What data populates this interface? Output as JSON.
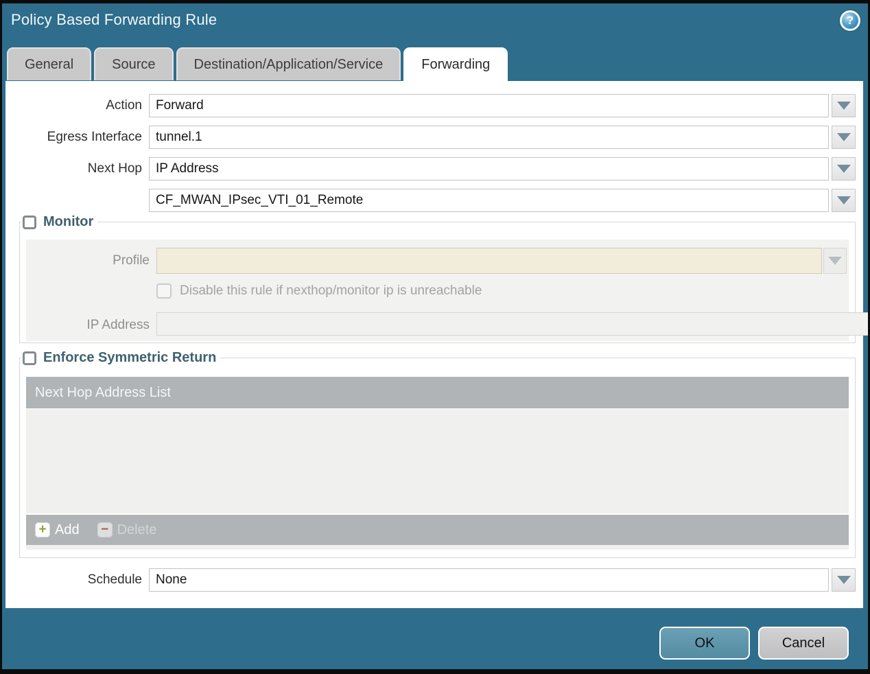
{
  "dialog": {
    "title": "Policy Based Forwarding Rule"
  },
  "icons": {
    "help": "?",
    "add_plus": "+",
    "delete_minus": "−"
  },
  "tabs": [
    {
      "label": "General",
      "active": false
    },
    {
      "label": "Source",
      "active": false
    },
    {
      "label": "Destination/Application/Service",
      "active": false
    },
    {
      "label": "Forwarding",
      "active": true
    }
  ],
  "form": {
    "action": {
      "label": "Action",
      "value": "Forward"
    },
    "egress_interface": {
      "label": "Egress Interface",
      "value": "tunnel.1"
    },
    "next_hop": {
      "label": "Next Hop",
      "value": "IP Address"
    },
    "next_hop_address": {
      "value": "CF_MWAN_IPsec_VTI_01_Remote"
    },
    "schedule": {
      "label": "Schedule",
      "value": "None"
    }
  },
  "monitor": {
    "legend": "Monitor",
    "checked": false,
    "profile": {
      "label": "Profile",
      "value": "",
      "disabled": true
    },
    "disable_rule_checkbox": {
      "label": "Disable this rule if nexthop/monitor ip is unreachable",
      "checked": false,
      "disabled": true
    },
    "ip_address": {
      "label": "IP Address",
      "value": "",
      "disabled": true
    }
  },
  "symmetric_return": {
    "legend": "Enforce Symmetric Return",
    "checked": false,
    "table": {
      "header": "Next Hop Address List",
      "rows": []
    },
    "add_label": "Add",
    "delete_label": "Delete",
    "delete_disabled": true
  },
  "footer": {
    "ok_label": "OK",
    "cancel_label": "Cancel"
  },
  "colors": {
    "frame_blue": "#2e6d8c",
    "tab_inactive_bg": "#c9c9c9",
    "active_tab_bg": "#ffffff",
    "legend_text": "#40616f",
    "table_header_bg": "#b0b4b7",
    "table_body_bg": "#f0f0ef",
    "profile_field_bg": "#f2edda",
    "disabled_text": "#a3a3a3",
    "ok_button_bg": "#5d95ab",
    "cancel_button_bg": "#c9c9cb",
    "add_icon_green": "#8ea338",
    "delete_icon_red": "#a65c50"
  }
}
